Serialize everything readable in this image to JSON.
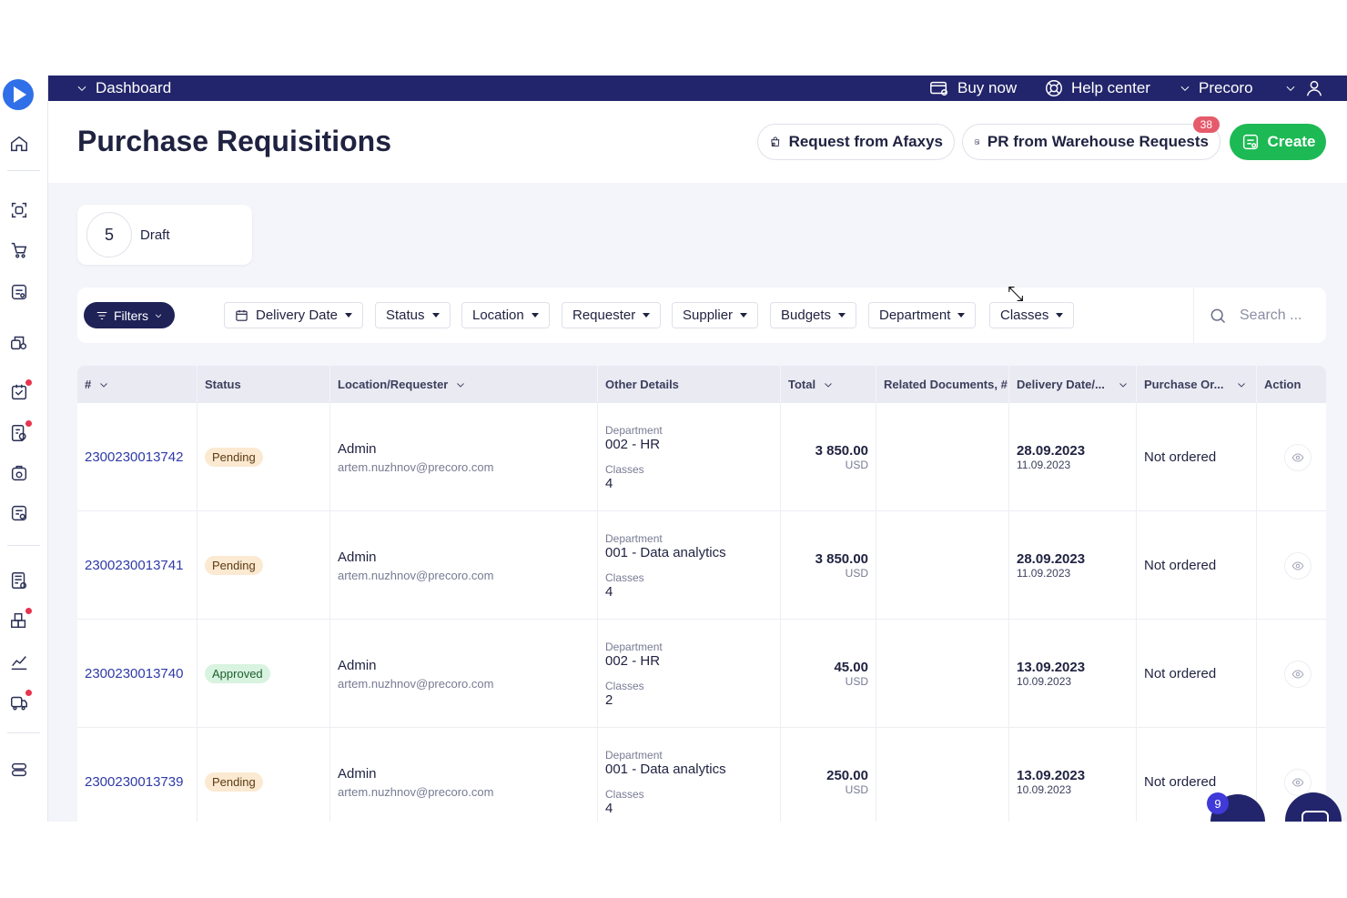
{
  "topbar": {
    "dashboard": "Dashboard",
    "buy_now": "Buy now",
    "help_center": "Help center",
    "company": "Precoro"
  },
  "header": {
    "title": "Purchase Requisitions",
    "request_from": "Request from Afaxys",
    "pr_from_warehouse": "PR from Warehouse Requests",
    "warehouse_badge": "38",
    "create": "Create"
  },
  "draft": {
    "count": "5",
    "label": "Draft"
  },
  "filters": {
    "filters_label": "Filters",
    "chips": [
      "Delivery Date",
      "Status",
      "Location",
      "Requester",
      "Supplier",
      "Budgets",
      "Department",
      "Classes"
    ],
    "search_placeholder": "Search ..."
  },
  "table": {
    "columns": [
      "#",
      "Status",
      "Location/Requester",
      "Other Details",
      "Total",
      "Related Documents, #",
      "Delivery Date/...",
      "Purchase Or...",
      "Action"
    ],
    "rows": [
      {
        "number": "2300230013742",
        "status": "Pending",
        "requester": "Admin",
        "email": "artem.nuzhnov@precoro.com",
        "dept_label": "Department",
        "dept": "002 - HR",
        "classes_label": "Classes",
        "classes": "4",
        "total": "3 850.00",
        "currency": "USD",
        "delivery": "28.09.2023",
        "created": "11.09.2023",
        "po": "Not ordered"
      },
      {
        "number": "2300230013741",
        "status": "Pending",
        "requester": "Admin",
        "email": "artem.nuzhnov@precoro.com",
        "dept_label": "Department",
        "dept": "001 - Data analytics",
        "classes_label": "Classes",
        "classes": "4",
        "total": "3 850.00",
        "currency": "USD",
        "delivery": "28.09.2023",
        "created": "11.09.2023",
        "po": "Not ordered"
      },
      {
        "number": "2300230013740",
        "status": "Approved",
        "requester": "Admin",
        "email": "artem.nuzhnov@precoro.com",
        "dept_label": "Department",
        "dept": "002 - HR",
        "classes_label": "Classes",
        "classes": "2",
        "total": "45.00",
        "currency": "USD",
        "delivery": "13.09.2023",
        "created": "10.09.2023",
        "po": "Not ordered"
      },
      {
        "number": "2300230013739",
        "status": "Pending",
        "requester": "Admin",
        "email": "artem.nuzhnov@precoro.com",
        "dept_label": "Department",
        "dept": "001 - Data analytics",
        "classes_label": "Classes",
        "classes": "4",
        "total": "250.00",
        "currency": "USD",
        "delivery": "13.09.2023",
        "created": "10.09.2023",
        "po": "Not ordered"
      }
    ]
  },
  "widgets": {
    "notification_count": "9"
  },
  "colors": {
    "topbar": "#22256b",
    "create": "#1db954",
    "link": "#2e3aa6",
    "pending_bg": "#fbe9d2",
    "approved_bg": "#d8f3df",
    "badge": "#e55b6b"
  },
  "icons": [
    "home-icon",
    "scan-icon",
    "cart-icon",
    "requisition-icon",
    "supplier-icon",
    "approval-icon",
    "orders-icon",
    "receipt-icon",
    "invoice-icon",
    "budget-icon",
    "warehouse-icon",
    "analytics-icon",
    "delivery-icon",
    "settings-icon",
    "eye-icon",
    "search-icon",
    "calendar-icon",
    "filter-icon"
  ]
}
